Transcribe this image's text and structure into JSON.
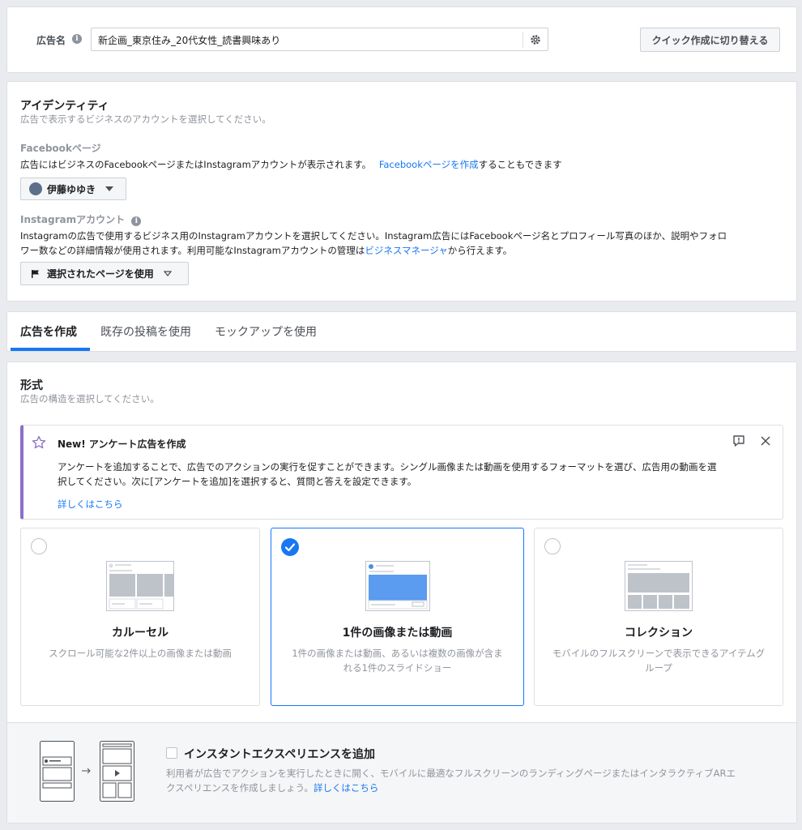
{
  "ad_name": {
    "label": "広告名",
    "value": "新企画_東京住み_20代女性_読書興味あり",
    "switch_button": "クイック作成に切り替える"
  },
  "identity": {
    "title": "アイデンティティ",
    "subtitle": "広告で表示するビジネスのアカウントを選択してください。",
    "fb_label": "Facebookページ",
    "fb_desc": "広告にはビジネスのFacebookページまたはInstagramアカウントが表示されます。",
    "fb_link": "Facebookページを作成",
    "fb_suffix": "することもできます",
    "fb_page_name": "伊藤ゆゆき",
    "ig_label": "Instagramアカウント",
    "ig_desc_line1": "Instagramの広告で使用するビジネス用のInstagramアカウントを選択してください。Instagram広告にはFacebookページ名とプロフィール写真のほか、説明やフォロ",
    "ig_desc_line2": "ワー数などの詳細情報が使用されます。利用可能なInstagramアカウントの管理は",
    "ig_link": "ビジネスマネージャ",
    "ig_suffix": "から行えます。",
    "ig_select": "選択されたページを使用"
  },
  "tabs": [
    {
      "label": "広告を作成",
      "active": true
    },
    {
      "label": "既存の投稿を使用",
      "active": false
    },
    {
      "label": "モックアップを使用",
      "active": false
    }
  ],
  "format": {
    "title": "形式",
    "subtitle": "広告の構造を選択してください。",
    "notice": {
      "title": "New! アンケート広告を作成",
      "line1": "アンケートを追加することで、広告でのアクションの実行を促すことができます。シングル画像または動画を使用するフォーマットを選び、広告用の動画を選",
      "line2": "択してください。次に[アンケートを追加]を選択すると、質問と答えを設定できます。",
      "link": "詳しくはこちら"
    },
    "options": [
      {
        "title": "カルーセル",
        "desc": "スクロール可能な2件以上の画像または動画",
        "selected": false
      },
      {
        "title": "1件の画像または動画",
        "desc": "1件の画像または動画、あるいは複数の画像が含まれる1件のスライドショー",
        "selected": true
      },
      {
        "title": "コレクション",
        "desc": "モバイルのフルスクリーンで表示できるアイテムグループ",
        "selected": false
      }
    ],
    "instant": {
      "title": "インスタントエクスペリエンスを追加",
      "line1": "利用者が広告でアクションを実行したときに開く、モバイルに最適なフルスクリーンのランディングページまたはインタラクティブARエ",
      "line2": "クスペリエンスを作成しましょう。",
      "link": "詳しくはこちら"
    }
  },
  "colors": {
    "accent": "#1877f2",
    "notice_bar": "#8c6fc9"
  }
}
